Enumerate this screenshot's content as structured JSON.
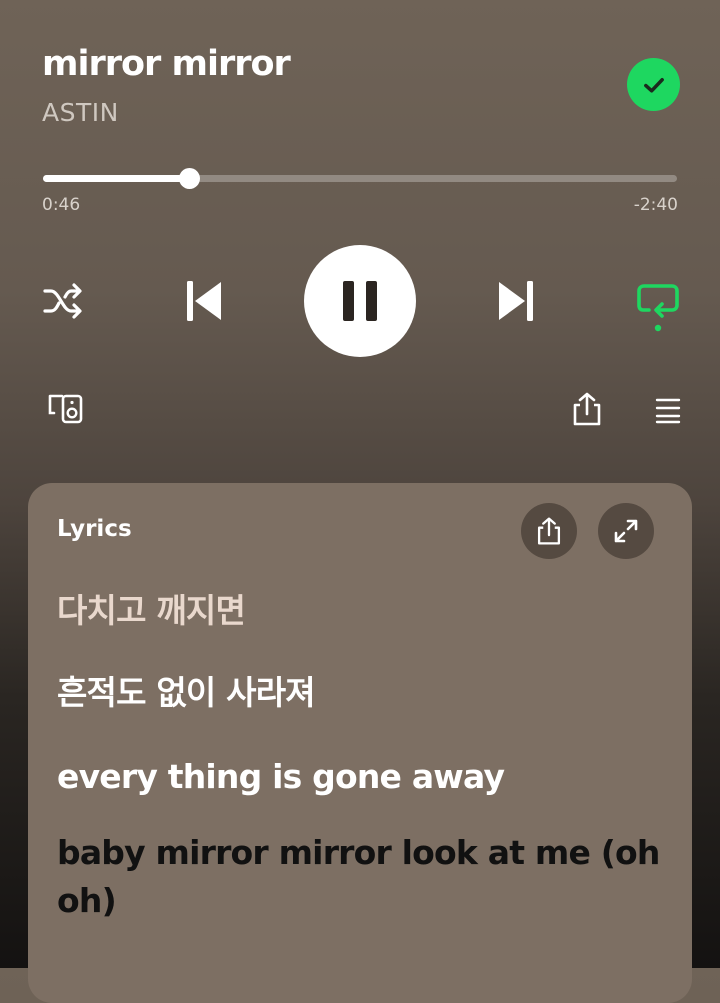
{
  "track": {
    "title": "mirror mirror",
    "artist": "ASTIN"
  },
  "progress": {
    "elapsed": "0:46",
    "remaining": "-2:40",
    "fraction": 0.23
  },
  "controls": {
    "shuffle_icon": "shuffle-icon",
    "previous_icon": "skip-previous-icon",
    "play_state": "playing",
    "next_icon": "skip-next-icon",
    "repeat_icon": "repeat-icon",
    "repeat_active": true
  },
  "toolbar": {
    "connect_icon": "connect-device-icon",
    "share_icon": "share-icon",
    "queue_icon": "queue-icon"
  },
  "lyrics": {
    "heading": "Lyrics",
    "lines": [
      "다치고 깨지면",
      "흔적도 없이 사라져",
      "every thing is gone away",
      "baby mirror mirror look at me (oh oh)"
    ]
  },
  "colors": {
    "accent": "#1ed760",
    "panel": "#7d6f63",
    "panel_button": "#554a41"
  }
}
